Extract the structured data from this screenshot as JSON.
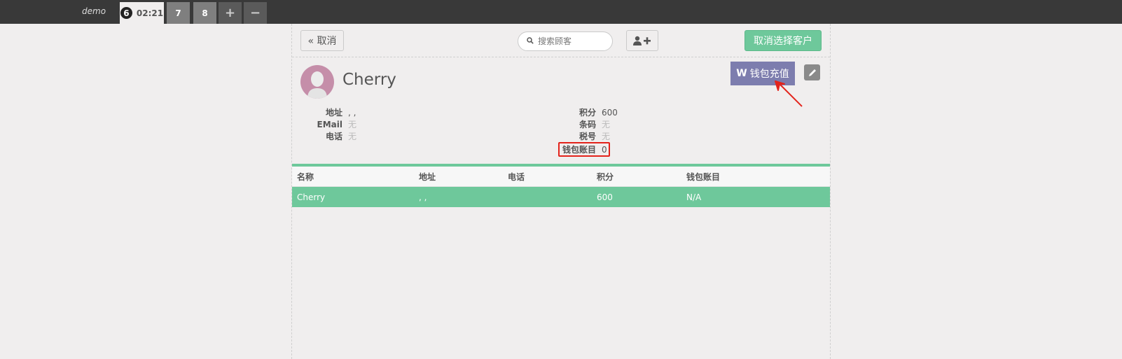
{
  "topbar": {
    "shop_name": "demo",
    "active_order": {
      "sequence": "6",
      "time": "02:21"
    },
    "other_orders": [
      "7",
      "8"
    ],
    "add_label": "+",
    "remove_label": "−"
  },
  "toolbar": {
    "cancel_label": "« 取消",
    "search_placeholder": "搜索顾客",
    "add_customer_icon": "user-plus-icon",
    "deselect_label": "取消选择客户"
  },
  "customer": {
    "name": "Cherry",
    "wallet_button_label": "钱包充值",
    "details_left": [
      {
        "label": "地址",
        "value": ", ,",
        "empty": false
      },
      {
        "label": "EMail",
        "value": "无",
        "empty": true
      },
      {
        "label": "电话",
        "value": "无",
        "empty": true
      }
    ],
    "details_right": [
      {
        "label": "积分",
        "value": "600",
        "empty": false
      },
      {
        "label": "条码",
        "value": "无",
        "empty": true
      },
      {
        "label": "税号",
        "value": "无",
        "empty": true
      },
      {
        "label": "钱包账目",
        "value": "0",
        "empty": false
      }
    ]
  },
  "table": {
    "headers": [
      "名称",
      "地址",
      "电话",
      "积分",
      "钱包账目"
    ],
    "rows": [
      [
        "Cherry",
        ", ,",
        "",
        "600",
        "N/A"
      ]
    ]
  },
  "colors": {
    "accent": "#6ec89b",
    "wallet": "#7d7dae",
    "highlight": "#e3231b"
  }
}
